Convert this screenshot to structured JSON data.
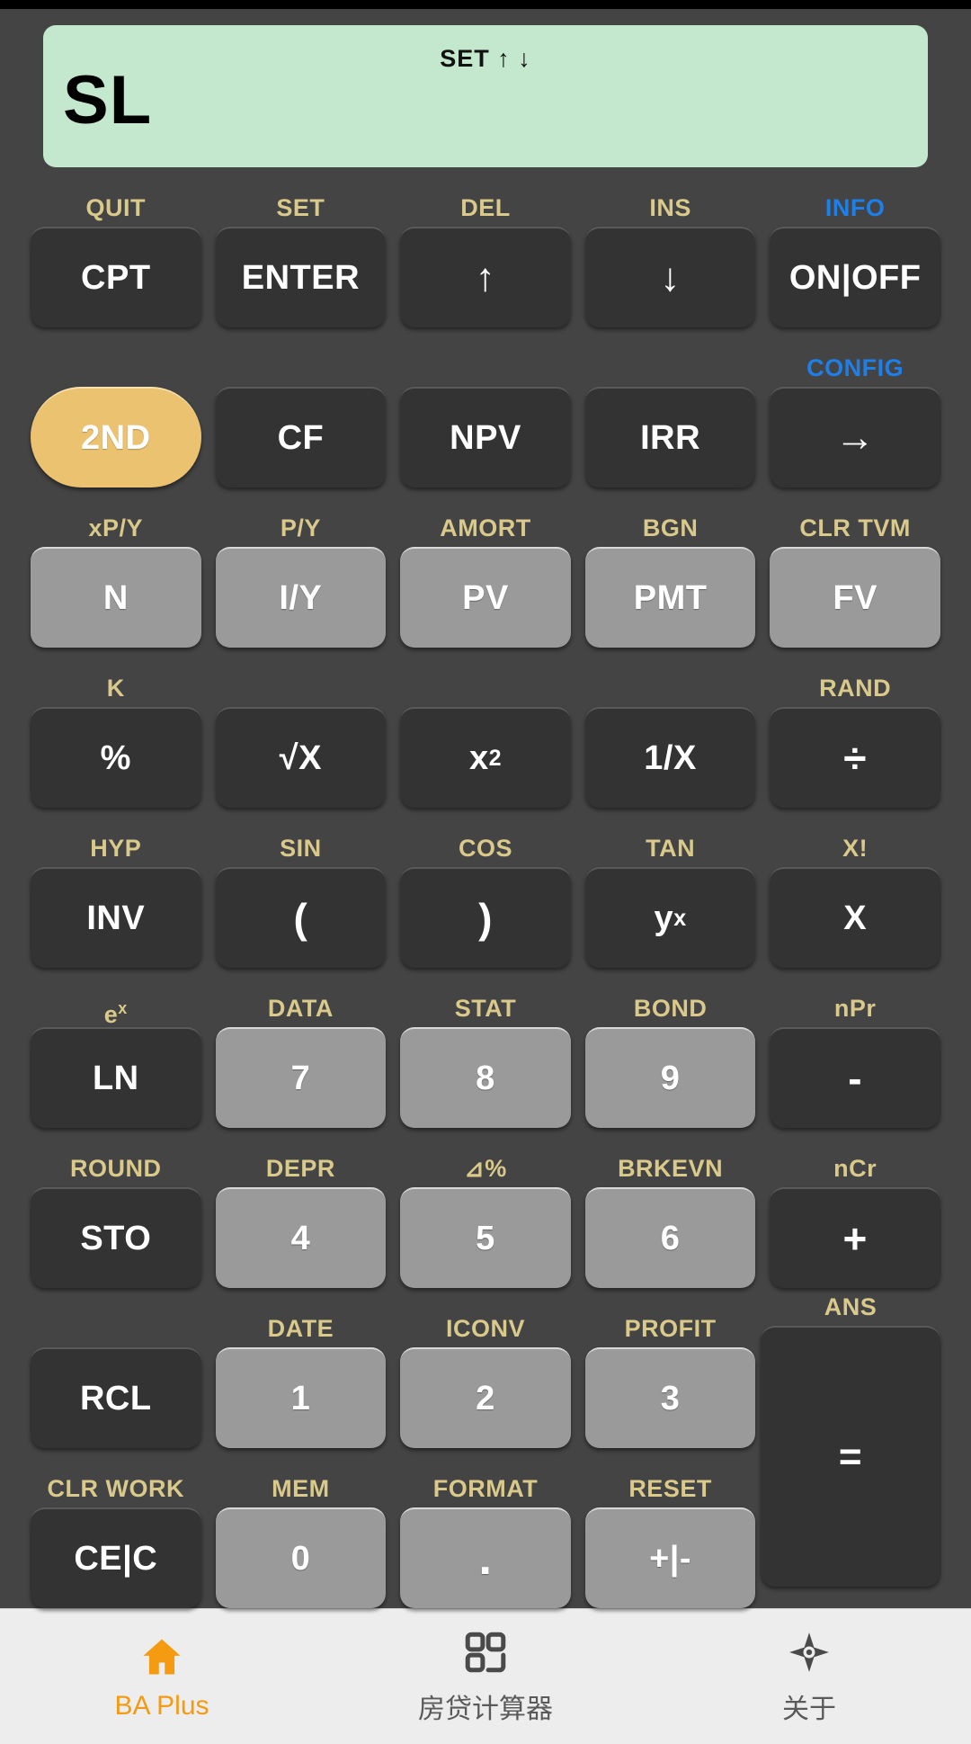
{
  "display": {
    "indicators": "SET ↑ ↓",
    "value": "SL"
  },
  "colors": {
    "display_bg": "#C3E8CE",
    "body_bg": "#444444",
    "key_dark": "#333333",
    "key_gray": "#9A9A9A",
    "key_amber": "#EBC270",
    "second_label": "#D9C98A",
    "blue_label": "#1E7FE8",
    "nav_active": "#F49B12"
  },
  "keypad": {
    "rows": [
      {
        "keys": [
          {
            "label": "CPT",
            "second": "QUIT",
            "style": "dark",
            "name": "key-cpt"
          },
          {
            "label": "ENTER",
            "second": "SET",
            "style": "dark",
            "name": "key-enter"
          },
          {
            "label": "↑",
            "second": "DEL",
            "style": "dark-arrow",
            "name": "key-up"
          },
          {
            "label": "↓",
            "second": "INS",
            "style": "dark-arrow",
            "name": "key-down"
          },
          {
            "label": "ON|OFF",
            "second": "INFO",
            "style": "dark",
            "second_color": "blue",
            "name": "key-on-off"
          }
        ]
      },
      {
        "keys": [
          {
            "label": "2ND",
            "second": "",
            "style": "amber",
            "name": "key-2nd"
          },
          {
            "label": "CF",
            "second": "",
            "style": "dark",
            "name": "key-cf"
          },
          {
            "label": "NPV",
            "second": "",
            "style": "dark",
            "name": "key-npv"
          },
          {
            "label": "IRR",
            "second": "",
            "style": "dark",
            "name": "key-irr"
          },
          {
            "label": "→",
            "second": "CONFIG",
            "style": "dark-arrow",
            "second_color": "blue",
            "name": "key-right-arrow"
          }
        ]
      },
      {
        "keys": [
          {
            "label": "N",
            "second": "xP/Y",
            "style": "gray",
            "name": "key-n"
          },
          {
            "label": "I/Y",
            "second": "P/Y",
            "style": "gray",
            "name": "key-iy"
          },
          {
            "label": "PV",
            "second": "AMORT",
            "style": "gray",
            "name": "key-pv"
          },
          {
            "label": "PMT",
            "second": "BGN",
            "style": "gray",
            "name": "key-pmt"
          },
          {
            "label": "FV",
            "second": "CLR TVM",
            "style": "gray",
            "name": "key-fv"
          }
        ]
      },
      {
        "keys": [
          {
            "label": "%",
            "second": "K",
            "style": "dark",
            "name": "key-percent"
          },
          {
            "label": "√X",
            "second": "",
            "style": "dark",
            "name": "key-sqrt"
          },
          {
            "label": "x²",
            "second": "",
            "style": "dark-sup",
            "base": "x",
            "sup": "2",
            "name": "key-square"
          },
          {
            "label": "1/X",
            "second": "",
            "style": "dark",
            "name": "key-reciprocal"
          },
          {
            "label": "÷",
            "second": "RAND",
            "style": "dark-bigop",
            "name": "key-divide"
          }
        ]
      },
      {
        "keys": [
          {
            "label": "INV",
            "second": "HYP",
            "style": "dark",
            "name": "key-inv"
          },
          {
            "label": "(",
            "second": "SIN",
            "style": "dark-bigop",
            "name": "key-open-paren"
          },
          {
            "label": ")",
            "second": "COS",
            "style": "dark-bigop",
            "name": "key-close-paren"
          },
          {
            "label": "yˣ",
            "second": "TAN",
            "style": "dark-sup",
            "base": "y",
            "sup": "x",
            "name": "key-power"
          },
          {
            "label": "X",
            "second": "X!",
            "style": "dark",
            "name": "key-multiply"
          }
        ]
      },
      {
        "keys": [
          {
            "label": "LN",
            "second": "eˣ",
            "style": "dark",
            "second_sup": {
              "base": "e",
              "sup": "x"
            },
            "name": "key-ln"
          },
          {
            "label": "7",
            "second": "DATA",
            "style": "gray",
            "name": "key-7"
          },
          {
            "label": "8",
            "second": "STAT",
            "style": "gray",
            "name": "key-8"
          },
          {
            "label": "9",
            "second": "BOND",
            "style": "gray",
            "name": "key-9"
          },
          {
            "label": "-",
            "second": "nPr",
            "style": "dark-bigop",
            "name": "key-minus"
          }
        ]
      },
      {
        "keys": [
          {
            "label": "STO",
            "second": "ROUND",
            "style": "dark",
            "name": "key-sto"
          },
          {
            "label": "4",
            "second": "DEPR",
            "style": "gray",
            "name": "key-4"
          },
          {
            "label": "5",
            "second": "⊿%",
            "style": "gray",
            "name": "key-5"
          },
          {
            "label": "6",
            "second": "BRKEVN",
            "style": "gray",
            "name": "key-6"
          },
          {
            "label": "+",
            "second": "nCr",
            "style": "dark-bigop",
            "name": "key-plus"
          }
        ]
      },
      {
        "keys": [
          {
            "label": "RCL",
            "second": "",
            "style": "dark",
            "name": "key-rcl"
          },
          {
            "label": "1",
            "second": "DATE",
            "style": "gray",
            "name": "key-1"
          },
          {
            "label": "2",
            "second": "ICONV",
            "style": "gray",
            "name": "key-2"
          },
          {
            "label": "3",
            "second": "PROFIT",
            "style": "gray",
            "name": "key-3"
          }
        ]
      },
      {
        "keys": [
          {
            "label": "CE|C",
            "second": "CLR WORK",
            "style": "dark",
            "name": "key-ce-c"
          },
          {
            "label": "0",
            "second": "MEM",
            "style": "gray",
            "name": "key-0"
          },
          {
            "label": ".",
            "second": "FORMAT",
            "style": "gray-dot",
            "name": "key-decimal"
          },
          {
            "label": "+|-",
            "second": "RESET",
            "style": "gray",
            "name": "key-sign"
          }
        ]
      }
    ],
    "equals": {
      "label": "=",
      "second": "ANS",
      "name": "key-equals"
    }
  },
  "bottom_nav": {
    "items": [
      {
        "label": "BA Plus",
        "icon": "home-icon",
        "active": true,
        "name": "nav-ba-plus"
      },
      {
        "label": "房贷计算器",
        "icon": "grid-icon",
        "active": false,
        "name": "nav-mortgage-calculator"
      },
      {
        "label": "关于",
        "icon": "compass-icon",
        "active": false,
        "name": "nav-about"
      }
    ]
  }
}
